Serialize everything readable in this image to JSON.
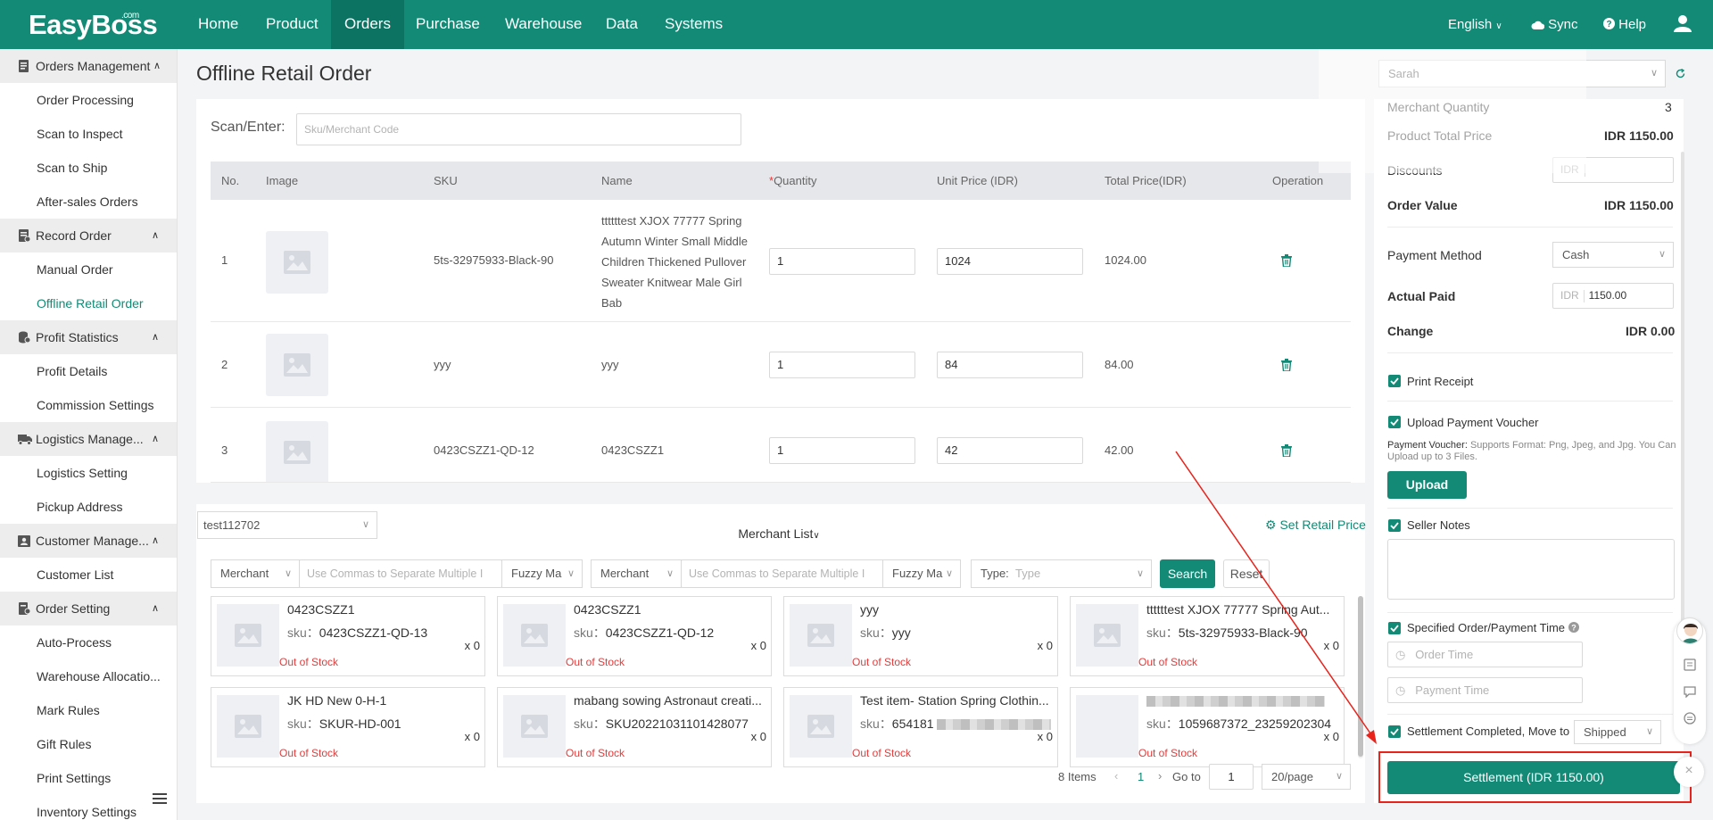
{
  "topnav": {
    "logo": "EasyBoss",
    "logo_sup": ".com",
    "items": [
      "Home",
      "Product",
      "Orders",
      "Purchase",
      "Warehouse",
      "Data",
      "Systems"
    ],
    "active_index": 2,
    "language": "English",
    "sync": "Sync",
    "help": "Help"
  },
  "sidebar": {
    "groups": [
      {
        "label": "Orders Management",
        "items": [
          "Order Processing",
          "Scan to Inspect",
          "Scan to Ship",
          "After-sales Orders"
        ]
      },
      {
        "label": "Record Order",
        "items": [
          "Manual Order",
          "Offline Retail Order"
        ]
      },
      {
        "label": "Profit Statistics",
        "items": [
          "Profit Details",
          "Commission Settings"
        ]
      },
      {
        "label": "Logistics Manage...",
        "items": [
          "Logistics Setting",
          "Pickup Address"
        ]
      },
      {
        "label": "Customer Manage...",
        "items": [
          "Customer List"
        ]
      },
      {
        "label": "Order Setting",
        "items": [
          "Auto-Process",
          "Warehouse Allocatio...",
          "Mark Rules",
          "Gift Rules",
          "Print Settings",
          "Inventory Settings"
        ]
      }
    ],
    "active_item": "Offline Retail Order"
  },
  "page": {
    "title": "Offline Retail Order"
  },
  "scan": {
    "label": "Scan/Enter:",
    "placeholder": "Sku/Merchant Code"
  },
  "table": {
    "headers": [
      "No.",
      "Image",
      "SKU",
      "Name",
      "*Quantity",
      "Unit Price (IDR)",
      "Total Price(IDR)",
      "Operation"
    ],
    "rows": [
      {
        "no": "1",
        "sku": "5ts-32975933-Black-90",
        "name": "ttttttest XJOX 77777 Spring Autumn Winter Small Middle Children Thickened Pullover Sweater Knitwear Male Girl Bab",
        "quantity": "1",
        "unit_price": "1024",
        "total": "1024.00"
      },
      {
        "no": "2",
        "sku": "yyy",
        "name": "yyy",
        "quantity": "1",
        "unit_price": "84",
        "total": "84.00"
      },
      {
        "no": "3",
        "sku": "0423CSZZ1-QD-12",
        "name": "0423CSZZ1",
        "quantity": "1",
        "unit_price": "42",
        "total": "42.00"
      }
    ]
  },
  "merchant": {
    "store_select": "test112702",
    "tab_label": "Merchant List",
    "set_retail_price": "Set Retail Price",
    "filter1_type": "Merchant",
    "filter1_placeholder": "Use Commas to Separate Multiple I",
    "filter1_mode": "Fuzzy Ma",
    "filter2_type": "Merchant",
    "filter2_placeholder": "Use Commas to Separate Multiple I",
    "filter2_mode": "Fuzzy Ma",
    "type_label": "Type:",
    "type_placeholder": "Type",
    "search_button": "Search",
    "reset_button": "Reset",
    "cards": [
      {
        "name": "0423CSZZ1",
        "sku_label": "sku：",
        "sku": "0423CSZZ1-QD-13",
        "qty": "x 0",
        "status": "Out of Stock"
      },
      {
        "name": "0423CSZZ1",
        "sku_label": "sku：",
        "sku": "0423CSZZ1-QD-12",
        "qty": "x 0",
        "status": "Out of Stock"
      },
      {
        "name": "yyy",
        "sku_label": "sku：",
        "sku": "yyy",
        "qty": "x 0",
        "status": "Out of Stock"
      },
      {
        "name": "ttttttest XJOX 77777 Spring Aut...",
        "sku_label": "sku：",
        "sku": "5ts-32975933-Black-90",
        "qty": "x 0",
        "status": "Out of Stock"
      },
      {
        "name": "JK HD New 0-H-1",
        "sku_label": "sku：",
        "sku": "SKUR-HD-001",
        "qty": "x 0",
        "status": "Out of Stock"
      },
      {
        "name": "mabang sowing Astronaut creati...",
        "sku_label": "sku：",
        "sku": "SKU20221031101428077",
        "qty": "x 0",
        "status": "Out of Stock"
      },
      {
        "name": "Test item- Station Spring Clothin...",
        "sku_label": "sku：",
        "sku": "654181",
        "qty": "x 0",
        "status": "Out of Stock"
      },
      {
        "name": "",
        "sku_label": "sku：",
        "sku": "1059687372_23259202304",
        "qty": "x 0",
        "status": "Out of Stock"
      }
    ],
    "pager": {
      "total": "8 Items",
      "page": "1",
      "goto_label": "Go to",
      "goto_value": "1",
      "page_size": "20/page"
    }
  },
  "summary": {
    "salesperson": "Sarah",
    "merchant_quantity_label": "Merchant Quantity",
    "merchant_quantity": "3",
    "product_total_label": "Product Total Price",
    "product_total": "IDR 1150.00",
    "discounts_label": "Discounts",
    "discounts_prefix": "IDR",
    "order_value_label": "Order Value",
    "order_value": "IDR 1150.00",
    "payment_method_label": "Payment Method",
    "payment_method": "Cash",
    "actual_paid_label": "Actual Paid",
    "actual_paid_prefix": "IDR",
    "actual_paid": "1150.00",
    "change_label": "Change",
    "change": "IDR 0.00",
    "print_receipt": "Print Receipt",
    "upload_voucher": "Upload Payment Voucher",
    "voucher_label": "Payment Voucher:",
    "voucher_hint": "Supports Format: Png, Jpeg, and Jpg. You Can Upload up to 3 Files.",
    "upload_button": "Upload",
    "seller_notes": "Seller Notes",
    "specified_time": "Specified Order/Payment Time",
    "order_time_placeholder": "Order Time",
    "payment_time_placeholder": "Payment Time",
    "settlement_completed": "Settlement Completed, Move to",
    "move_to": "Shipped",
    "settlement_button": "Settlement (IDR 1150.00)"
  },
  "colors": {
    "brand": "#128a76",
    "brand_dark": "#0c7262",
    "out_of_stock": "#e23c3c",
    "highlight": "#e8231b"
  }
}
